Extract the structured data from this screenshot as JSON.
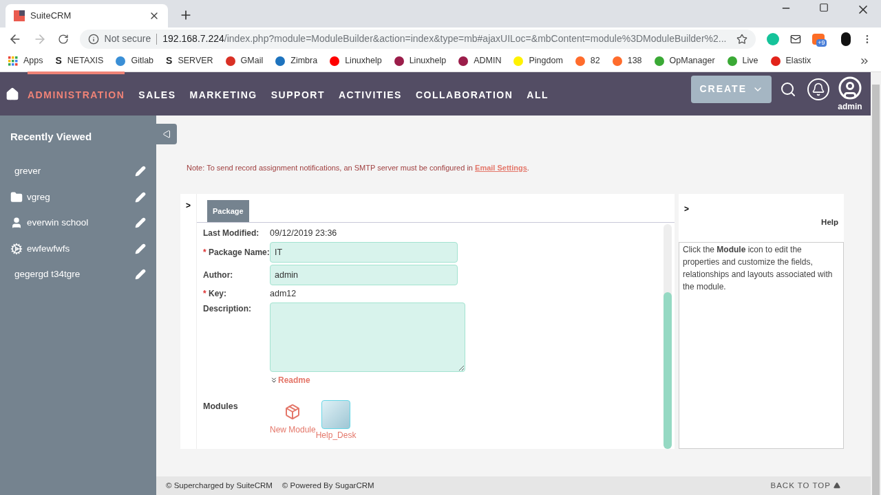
{
  "browser": {
    "tabs": [
      {
        "title": "SuiteCRM",
        "selected": true
      }
    ],
    "address": {
      "security": "Not secure",
      "host": "192.168.7.224",
      "path": "/index.php?module=ModuleBuilder&action=index&type=mb#ajaxUILoc=&mbContent=module%3DModuleBuilder%2..."
    },
    "extension_badge": "+9",
    "bookmarks": [
      {
        "label": "Apps",
        "kind": "apps"
      },
      {
        "label": "NETAXIS",
        "kind": "letter",
        "glyph": "S"
      },
      {
        "label": "Gitlab",
        "kind": "dot",
        "color": "#3a8fd6"
      },
      {
        "label": "SERVER",
        "kind": "letter",
        "glyph": "S"
      },
      {
        "label": "GMail",
        "kind": "dot",
        "color": "#d93025"
      },
      {
        "label": "Zimbra",
        "kind": "dot",
        "color": "#1e73be"
      },
      {
        "label": "Linuxhelp",
        "kind": "dot",
        "color": "#ff0000"
      },
      {
        "label": "Linuxhelp",
        "kind": "dot",
        "color": "#9b1d4a"
      },
      {
        "label": "ADMIN",
        "kind": "dot",
        "color": "#9b1d4a"
      },
      {
        "label": "Pingdom",
        "kind": "dot",
        "color": "#fff200"
      },
      {
        "label": "82",
        "kind": "dot",
        "color": "#ff6c2c"
      },
      {
        "label": "138",
        "kind": "dot",
        "color": "#ff6c2c"
      },
      {
        "label": "OpManager",
        "kind": "dot",
        "color": "#3aa935"
      },
      {
        "label": "Live",
        "kind": "dot",
        "color": "#3aa935"
      },
      {
        "label": "Elastix",
        "kind": "dot",
        "color": "#e2231a"
      }
    ]
  },
  "nav": {
    "items": [
      {
        "label": "ADMINISTRATION",
        "selected": true
      },
      {
        "label": "SALES",
        "selected": false
      },
      {
        "label": "MARKETING",
        "selected": false
      },
      {
        "label": "SUPPORT",
        "selected": false
      },
      {
        "label": "ACTIVITIES",
        "selected": false
      },
      {
        "label": "COLLABORATION",
        "selected": false
      },
      {
        "label": "ALL",
        "selected": false
      }
    ],
    "create": "CREATE",
    "user": "admin"
  },
  "sidebar": {
    "title": "Recently Viewed",
    "items": [
      {
        "label": "grever",
        "kind": "none"
      },
      {
        "label": "vgreg",
        "kind": "folder"
      },
      {
        "label": "everwin school",
        "kind": "person"
      },
      {
        "label": "ewfewfwfs",
        "kind": "gear"
      },
      {
        "label": "gegergd t34tgre",
        "kind": "none"
      }
    ]
  },
  "note": {
    "text": "Note: To send record assignment notifications, an SMTP server must be configured in",
    "link": "Email Settings",
    "end": "."
  },
  "package": {
    "expander": ">",
    "tab": {
      "label": "Package",
      "selected": true
    },
    "fields": [
      {
        "label": "Last Modified:",
        "kind": "text",
        "value": "09/12/2019 23:36"
      },
      {
        "label": "Package Name:",
        "marker": "*",
        "kind": "input",
        "value": "IT"
      },
      {
        "label": "Author:",
        "kind": "input",
        "value": "admin"
      },
      {
        "label": "Key:",
        "marker": "*",
        "kind": "text",
        "value": "adm12"
      },
      {
        "label": "Description:",
        "kind": "textarea"
      }
    ],
    "readme": "Readme",
    "modules_label": "Modules",
    "modules": [
      {
        "label": "New Module",
        "kind": "new"
      },
      {
        "label": "Help_Desk",
        "kind": "module"
      }
    ]
  },
  "help": {
    "expander": ">",
    "title": "Help",
    "text": "Click the **Module** icon to edit the properties and customize the fields, relationships and layouts associated with the module."
  },
  "footer": {
    "left": [
      "© Supercharged by SuiteCRM",
      "© Powered By SugarCRM"
    ],
    "back_to_top": "BACK TO TOP"
  }
}
